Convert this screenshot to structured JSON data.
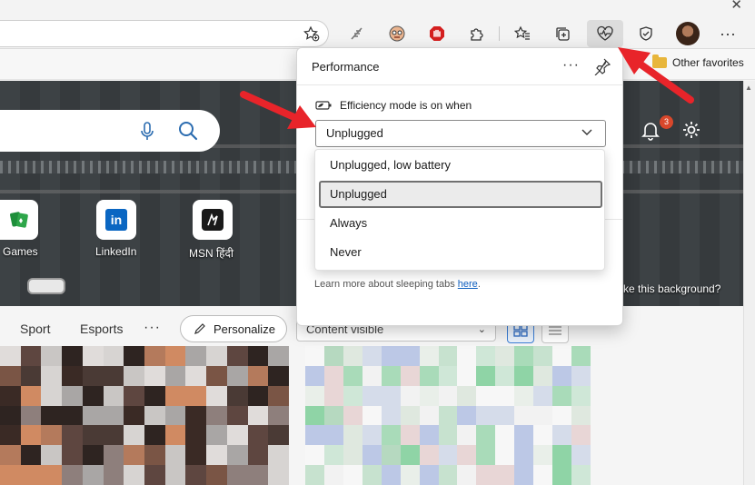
{
  "toolbar": {
    "close_symbol": "✕",
    "favorites_label": "Other favorites"
  },
  "hero": {
    "notification_count": "3",
    "tiles": [
      {
        "label": "Games"
      },
      {
        "label": "LinkedIn"
      },
      {
        "label": "MSN हिंदी"
      }
    ],
    "background_prompt": "ke this background?"
  },
  "feed": {
    "nav": [
      {
        "label": "Sport"
      },
      {
        "label": "Esports"
      }
    ],
    "more_label": "···",
    "personalize_label": "Personalize",
    "content_select_value": "Content visible"
  },
  "performance": {
    "title": "Performance",
    "efficiency_label": "Efficiency mode is on when",
    "selected_value": "Unplugged",
    "options": [
      {
        "label": "Unplugged, low battery"
      },
      {
        "label": "Unplugged"
      },
      {
        "label": "Always"
      },
      {
        "label": "Never"
      }
    ],
    "learn_more_text": "Learn more about sleeping tabs ",
    "learn_more_link": "here",
    "learn_more_suffix": "."
  },
  "colors": {
    "accent": "#0f5fbf",
    "annotation_arrow": "#e8242a",
    "badge": "#d9472b"
  }
}
